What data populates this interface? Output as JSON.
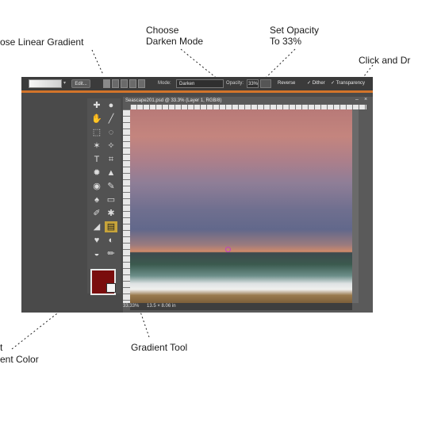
{
  "annotations": {
    "linear_gradient": "ose Linear Gradient",
    "darken_line1": "Choose",
    "darken_line2": "Darken Mode",
    "opacity_line1": "Set Opacity",
    "opacity_line2": "To 33%",
    "click_drag": "Click and Dr",
    "gradient_tool": "Gradient Tool",
    "fg_line1": "t",
    "fg_line2": "ent Color"
  },
  "options_bar": {
    "edit_label": "Edit...",
    "mode_label": "Mode:",
    "mode_value": "Darken",
    "opacity_label": "Opacity:",
    "opacity_value": "33%",
    "reverse_label": "Reverse",
    "dither_label": "✓ Dither",
    "transparency_label": "✓ Transparency"
  },
  "document": {
    "title": "Seascape201.psd @ 33.3% (Layer 1, RGB/8)",
    "minimize": "–",
    "close": "×",
    "zoom": "33.33%",
    "size": "13.5 × 8.06 in"
  },
  "toolbox": {
    "tools": [
      {
        "name": "move-icon",
        "glyph": "✚"
      },
      {
        "name": "zoom-icon",
        "glyph": "●"
      },
      {
        "name": "hand-icon",
        "glyph": "✋"
      },
      {
        "name": "eyedropper-icon",
        "glyph": "╱"
      },
      {
        "name": "marquee-icon",
        "glyph": "⬚"
      },
      {
        "name": "lasso-icon",
        "glyph": "◌"
      },
      {
        "name": "magic-wand-icon",
        "glyph": "✶"
      },
      {
        "name": "selection-brush-icon",
        "glyph": "✧"
      },
      {
        "name": "type-icon",
        "glyph": "T"
      },
      {
        "name": "crop-icon",
        "glyph": "⌗"
      },
      {
        "name": "cookie-cutter-icon",
        "glyph": "✹"
      },
      {
        "name": "straighten-icon",
        "glyph": "▲"
      },
      {
        "name": "red-eye-icon",
        "glyph": "◉"
      },
      {
        "name": "healing-brush-icon",
        "glyph": "✎"
      },
      {
        "name": "clone-stamp-icon",
        "glyph": "♠"
      },
      {
        "name": "eraser-icon",
        "glyph": "▭"
      },
      {
        "name": "brush-icon",
        "glyph": "✐"
      },
      {
        "name": "smart-brush-icon",
        "glyph": "✱"
      },
      {
        "name": "paint-bucket-icon",
        "glyph": "◢"
      },
      {
        "name": "gradient-icon",
        "glyph": "▤"
      },
      {
        "name": "shape-icon",
        "glyph": "♥"
      },
      {
        "name": "blur-icon",
        "glyph": "◐"
      },
      {
        "name": "sponge-icon",
        "glyph": "◒"
      },
      {
        "name": "pencil-icon",
        "glyph": "✏"
      }
    ],
    "fg_color": "#7a0d0d",
    "bg_color": "#f4f4f4"
  },
  "colors": {
    "accent": "#d3742a",
    "panel": "#4a4a4a"
  }
}
